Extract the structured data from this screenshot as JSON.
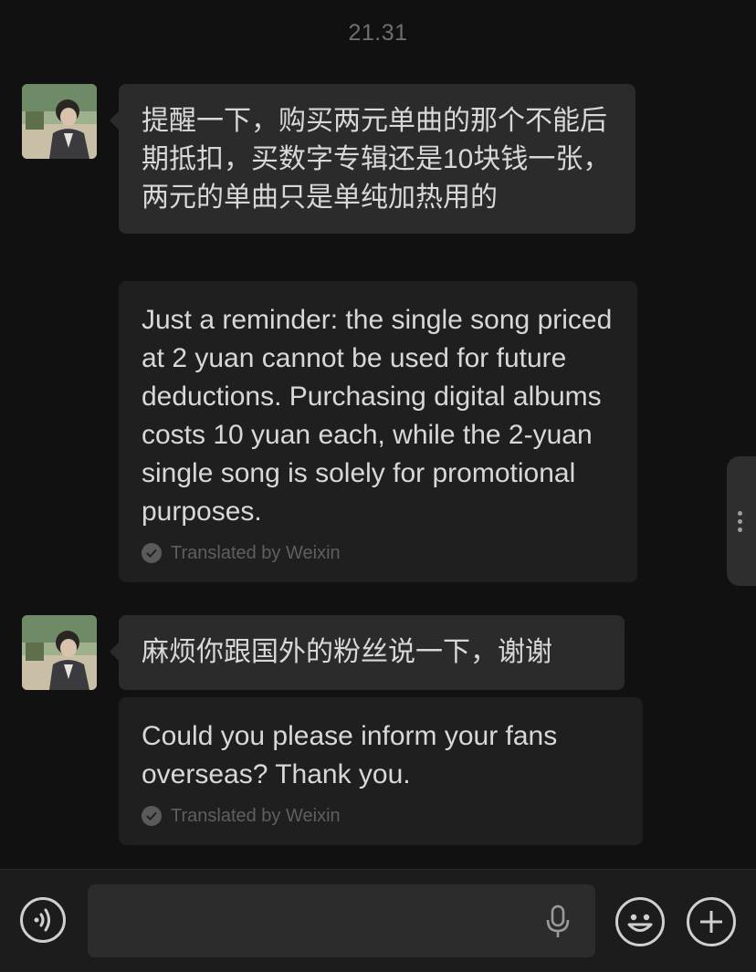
{
  "header": {
    "time": "21.31"
  },
  "messages": [
    {
      "original": "提醒一下，购买两元单曲的那个不能后期抵扣，买数字专辑还是10块钱一张，两元的单曲只是单纯加热用的",
      "translation": "Just a reminder: the single song priced at 2 yuan cannot be used for future deductions. Purchasing digital albums costs 10 yuan each, while the 2-yuan single song is solely for promotional purposes.",
      "translated_label": "Translated by Weixin"
    },
    {
      "original": "麻烦你跟国外的粉丝说一下，谢谢",
      "translation": "Could you please inform your fans overseas? Thank you.",
      "translated_label": "Translated by Weixin"
    }
  ],
  "input_bar": {
    "left_icon": "voice-toggle-icon",
    "mic_icon": "microphone-icon",
    "emoji_icon": "emoji-icon",
    "plus_icon": "plus-icon"
  },
  "colors": {
    "background": "#111111",
    "bubble": "#2b2b2b",
    "translation_bubble": "#1f1f1f",
    "muted_text": "#6e6e6e"
  }
}
